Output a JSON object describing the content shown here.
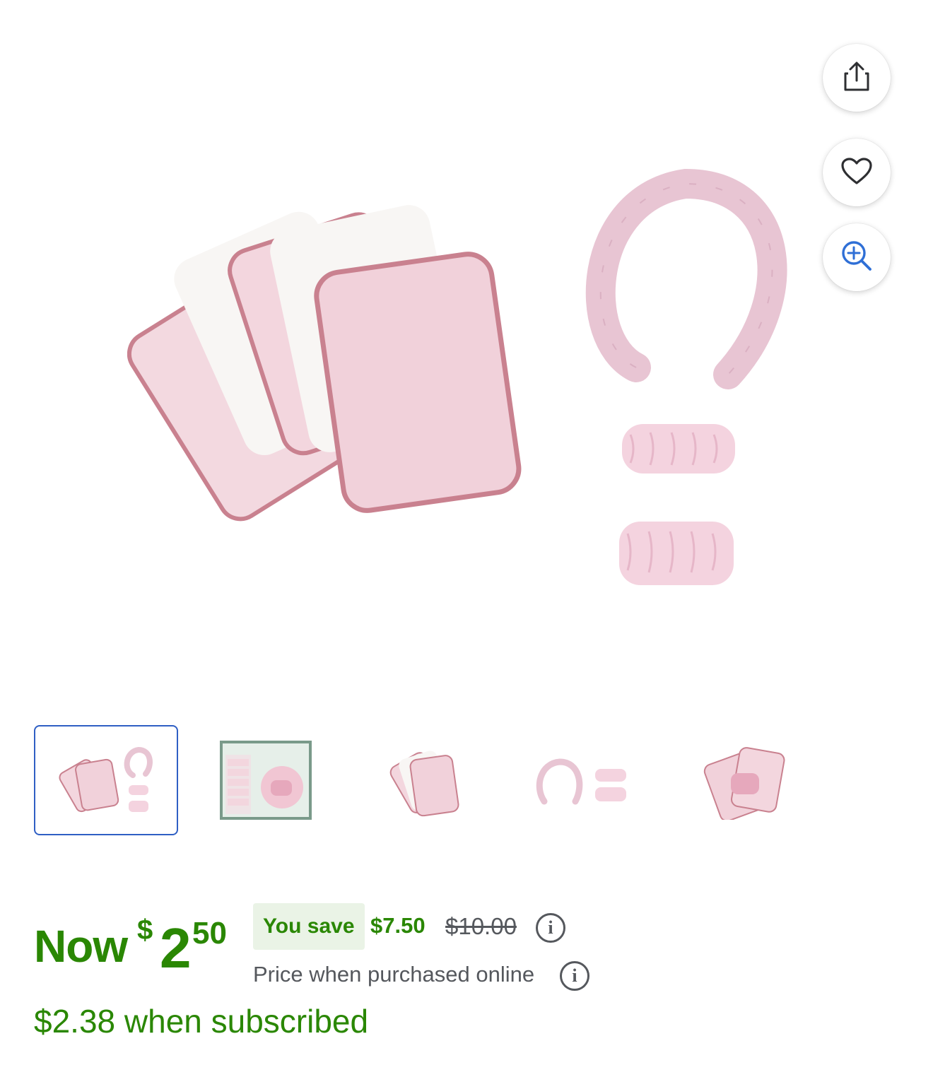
{
  "product": {
    "image_alt": "pink and white face towels with headband and wristbands",
    "thumbnails": [
      {
        "name": "thumbnail-1",
        "active": true
      },
      {
        "name": "thumbnail-2",
        "active": false
      },
      {
        "name": "thumbnail-3",
        "active": false
      },
      {
        "name": "thumbnail-4",
        "active": false
      },
      {
        "name": "thumbnail-5",
        "active": false
      }
    ]
  },
  "actions": {
    "share_icon": "share-icon",
    "favorite_icon": "heart-icon",
    "zoom_icon": "zoom-in-icon"
  },
  "pricing": {
    "now_label": "Now",
    "currency_symbol": "$",
    "price_dollars": "2",
    "price_cents": "50",
    "you_save_label": "You save",
    "save_amount": "$7.50",
    "was_price": "$10.00",
    "online_note": "Price when purchased online",
    "subscribed_price": "$2.38 when subscribed"
  },
  "colors": {
    "price_green": "#2a8703",
    "badge_bg": "#eaf3e6",
    "active_thumb_border": "#2f5fc4",
    "zoom_icon_blue": "#2f6fd6",
    "towel_pink": "#f1d4dd",
    "towel_edge": "#c9818f",
    "towel_white": "#f7f4f1"
  }
}
